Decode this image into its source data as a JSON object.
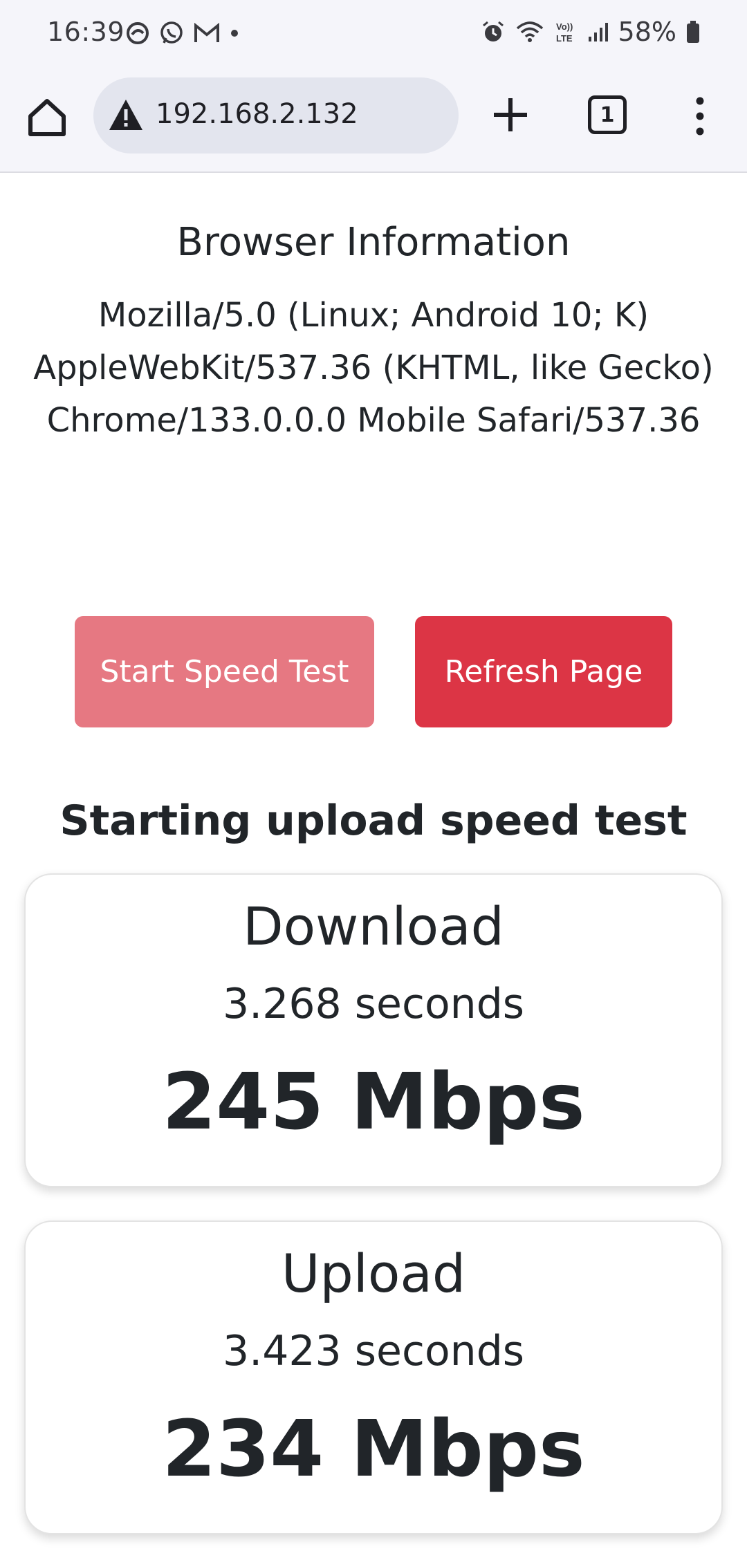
{
  "status_bar": {
    "time": "16:39",
    "battery": "58%",
    "left_icons": [
      "edge-icon",
      "whatsapp-icon",
      "gmail-icon",
      "dot-icon"
    ],
    "right_icons": [
      "alarm-icon",
      "wifi-icon",
      "volte-icon",
      "signal-icon",
      "battery-icon"
    ]
  },
  "browser": {
    "url": "192.168.2.132",
    "tab_count": "1"
  },
  "info": {
    "title": "Browser Information",
    "user_agent_line1": "Mozilla/5.0 (Linux; Android 10; K)",
    "user_agent_line2": "AppleWebKit/537.36 (KHTML, like Gecko)",
    "user_agent_line3": "Chrome/133.0.0.0 Mobile Safari/537.36"
  },
  "buttons": {
    "start": "Start Speed Test",
    "refresh": "Refresh Page"
  },
  "status_message": "Starting upload speed test",
  "results": {
    "download": {
      "label": "Download",
      "time": "3.268 seconds",
      "speed": "245 Mbps"
    },
    "upload": {
      "label": "Upload",
      "time": "3.423 seconds",
      "speed": "234 Mbps"
    }
  },
  "colors": {
    "start_button": "#e67882",
    "refresh_button": "#dc3545"
  }
}
